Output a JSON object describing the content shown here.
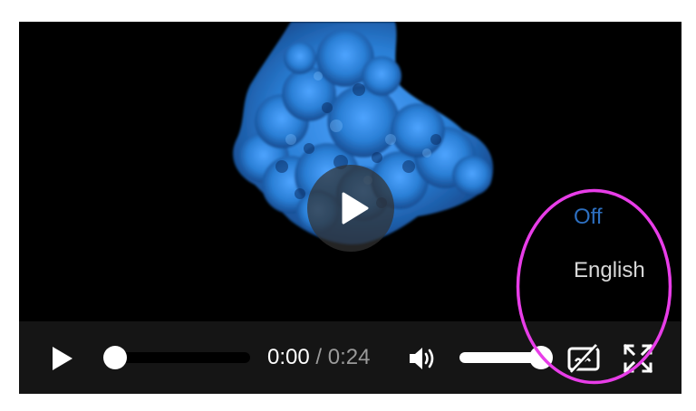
{
  "captions_menu": {
    "options": [
      "Off",
      "English"
    ],
    "selected": "Off"
  },
  "controls": {
    "current_time": "0:00",
    "separator": " / ",
    "duration": "0:24",
    "progress_fraction": 0.0,
    "volume_fraction": 1.0,
    "captions_enabled": false
  },
  "colors": {
    "selected_option": "#2d6fc0",
    "menu_text": "#d8d8d8",
    "control_bar": "#151515",
    "smoke": "#2a7fd6",
    "annotation_ring": "#e83de8"
  },
  "icons": [
    "play-icon",
    "big-play-icon",
    "volume-icon",
    "captions-off-icon",
    "fullscreen-icon"
  ]
}
